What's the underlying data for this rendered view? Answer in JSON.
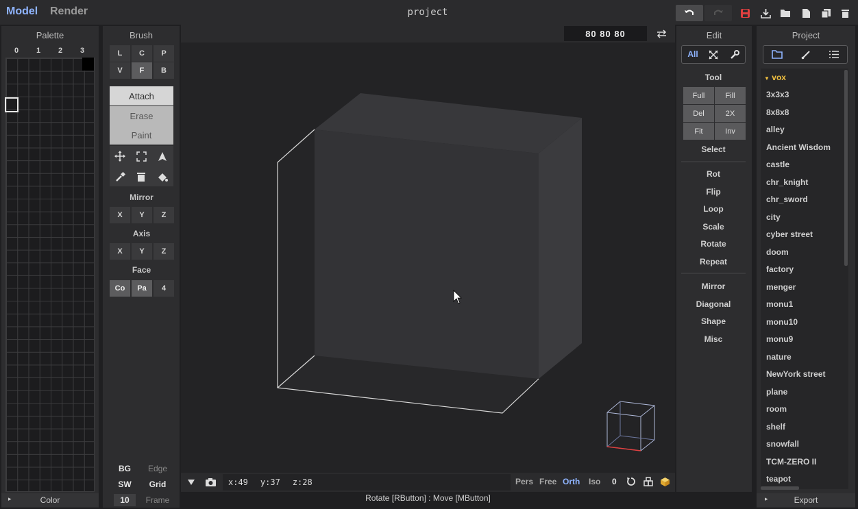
{
  "top_bar": {
    "tab_model": "Model",
    "tab_render": "Render",
    "project_title": "project",
    "icons": [
      "undo-icon",
      "redo-icon",
      "save-icon",
      "import-icon",
      "open-folder-icon",
      "new-file-icon",
      "duplicate-icon",
      "delete-icon"
    ]
  },
  "palette": {
    "title": "Palette",
    "page_numbers": [
      "0",
      "1",
      "2",
      "3"
    ],
    "footer_label": "Color"
  },
  "brush": {
    "title": "Brush",
    "row1": [
      "L",
      "C",
      "P"
    ],
    "row2": [
      "V",
      "F",
      "B"
    ],
    "active_shape": "F",
    "modes": [
      "Attach",
      "Erase",
      "Paint"
    ],
    "selected_mode": "Attach",
    "mirror_label": "Mirror",
    "mirror_buttons": [
      "X",
      "Y",
      "Z"
    ],
    "axis_label": "Axis",
    "axis_buttons": [
      "X",
      "Y",
      "Z"
    ],
    "face_label": "Face",
    "face_buttons": [
      "Co",
      "Pa",
      "4"
    ],
    "bottom": {
      "bg": "BG",
      "edge": "Edge",
      "sw": "SW",
      "grid": "Grid",
      "frame_value": "10",
      "frame": "Frame"
    }
  },
  "viewport": {
    "dimensions": "80 80 80",
    "coords": {
      "x": "x:49",
      "y": "y:37",
      "z": "z:28"
    },
    "projection_options": [
      "Pers",
      "Free",
      "Orth",
      "Iso"
    ],
    "active_projection": "Orth",
    "counter": "0",
    "status": "Rotate [RButton] : Move [MButton]"
  },
  "edit": {
    "title": "Edit",
    "filter_tabs": [
      "All"
    ],
    "tool_label": "Tool",
    "tool_buttons": [
      "Full",
      "Fill",
      "Del",
      "2X",
      "Fit",
      "Inv"
    ],
    "select_label": "Select",
    "ops": [
      "Rot",
      "Flip",
      "Loop",
      "Scale",
      "Rotate",
      "Repeat"
    ],
    "ops2": [
      "Mirror",
      "Diagonal",
      "Shape",
      "Misc"
    ]
  },
  "project": {
    "title": "Project",
    "folder": "vox",
    "items": [
      "3x3x3",
      "8x8x8",
      "alley",
      "Ancient Wisdom",
      "castle",
      "chr_knight",
      "chr_sword",
      "city",
      "cyber street",
      "doom",
      "factory",
      "menger",
      "monu1",
      "monu10",
      "monu9",
      "nature",
      "NewYork street",
      "plane",
      "room",
      "shelf",
      "snowfall",
      "TCM-ZERO II",
      "teapot"
    ],
    "export_label": "Export"
  },
  "colors": {
    "accent_blue": "#8fb4ff",
    "vox_folder": "#f0c040",
    "save_red": "#e04040"
  }
}
